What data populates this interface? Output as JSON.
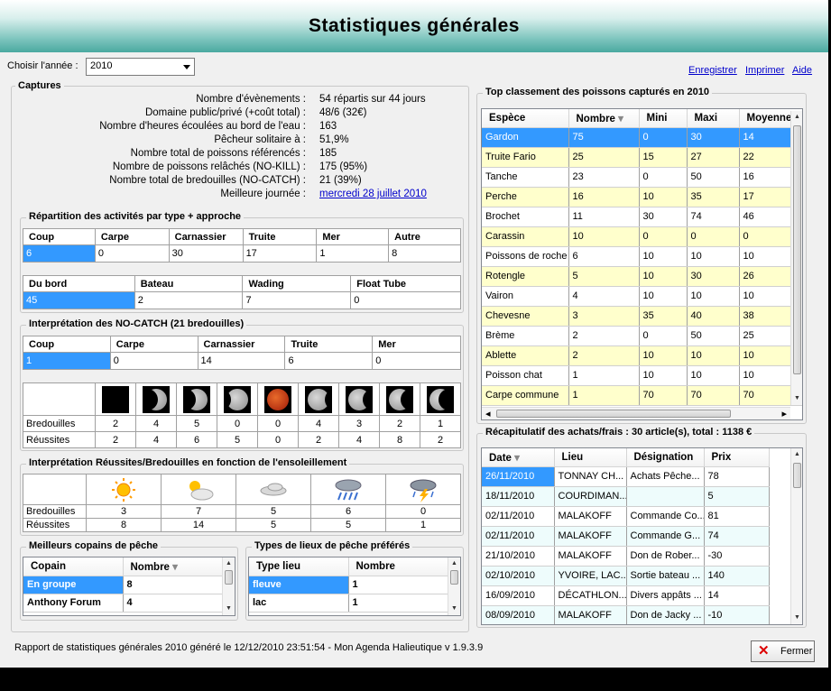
{
  "title": "Statistiques générales",
  "year_label": "Choisir l'année :",
  "year_value": "2010",
  "links": {
    "save": "Enregistrer",
    "print": "Imprimer",
    "help": "Aide"
  },
  "captures": {
    "title": "Captures",
    "stats": [
      {
        "label": "Nombre d'évènements :",
        "value": "54 répartis sur 44 jours"
      },
      {
        "label": "Domaine public/privé (+coût total) :",
        "value": "48/6  (32€)"
      },
      {
        "label": "Nombre d'heures écoulées au bord de l'eau :",
        "value": "163"
      },
      {
        "label": "Pêcheur solitaire à :",
        "value": "51,9%"
      },
      {
        "label": "Nombre total de poissons référencés :",
        "value": "185"
      },
      {
        "label": "Nombre de poissons relâchés (NO-KILL) :",
        "value": "175   (95%)"
      },
      {
        "label": "Nombre total de bredouilles (NO-CATCH) :",
        "value": "21   (39%)"
      },
      {
        "label": "Meilleure journée :",
        "value": "mercredi 28 juillet 2010"
      }
    ]
  },
  "activities": {
    "title": "Répartition des activités par type + approche",
    "type_headers": [
      "Coup",
      "Carpe",
      "Carnassier",
      "Truite",
      "Mer",
      "Autre"
    ],
    "type_values": [
      "6",
      "0",
      "30",
      "17",
      "1",
      "8"
    ],
    "approach_headers": [
      "Du bord",
      "Bateau",
      "Wading",
      "Float Tube"
    ],
    "approach_values": [
      "45",
      "2",
      "7",
      "0"
    ]
  },
  "nocatch": {
    "title": "Interprétation des NO-CATCH (21 bredouilles)",
    "headers": [
      "Coup",
      "Carpe",
      "Carnassier",
      "Truite",
      "Mer"
    ],
    "values": [
      "1",
      "0",
      "14",
      "6",
      "0"
    ],
    "row_labels": [
      "Bredouilles",
      "Réussites"
    ],
    "moons": [
      "new-moon-icon",
      "waxing-crescent-moon-icon",
      "first-quarter-moon-icon",
      "waxing-gibbous-moon-icon",
      "full-moon-icon",
      "waning-gibbous-moon-icon",
      "waning-gibbous-moon-icon",
      "last-quarter-moon-icon",
      "waning-crescent-moon-icon"
    ],
    "bredouilles": [
      "2",
      "4",
      "5",
      "0",
      "0",
      "4",
      "3",
      "2",
      "1"
    ],
    "reussites": [
      "2",
      "4",
      "6",
      "5",
      "0",
      "2",
      "4",
      "8",
      "2"
    ]
  },
  "weather": {
    "title": "Interprétation Réussites/Bredouilles en fonction de l'ensoleillement",
    "row_labels": [
      "Bredouilles",
      "Réussites"
    ],
    "icons": [
      "sun-icon",
      "sun-cloud-icon",
      "cloud-icon",
      "rain-icon",
      "storm-icon"
    ],
    "bredouilles": [
      "3",
      "7",
      "5",
      "6",
      "0"
    ],
    "reussites": [
      "8",
      "14",
      "5",
      "5",
      "1"
    ]
  },
  "buddies": {
    "title": "Meilleurs copains de pêche",
    "headers": [
      "Copain",
      "Nombre"
    ],
    "rows": [
      [
        "En groupe",
        "8"
      ],
      [
        "Anthony Forum",
        "4"
      ]
    ]
  },
  "places": {
    "title": "Types de lieux de pêche préférés",
    "headers": [
      "Type lieu",
      "Nombre"
    ],
    "rows": [
      [
        "fleuve",
        "1"
      ],
      [
        "lac",
        "1"
      ]
    ]
  },
  "top_fish": {
    "title": "Top classement des poissons capturés en 2010",
    "headers": [
      "Espèce",
      "Nombre",
      "Mini",
      "Maxi",
      "Moyenne"
    ],
    "rows": [
      [
        "Gardon",
        "75",
        "0",
        "30",
        "14"
      ],
      [
        "Truite Fario",
        "25",
        "15",
        "27",
        "22"
      ],
      [
        "Tanche",
        "23",
        "0",
        "50",
        "16"
      ],
      [
        "Perche",
        "16",
        "10",
        "35",
        "17"
      ],
      [
        "Brochet",
        "11",
        "30",
        "74",
        "46"
      ],
      [
        "Carassin",
        "10",
        "0",
        "0",
        "0"
      ],
      [
        "Poissons de roche",
        "6",
        "10",
        "10",
        "10"
      ],
      [
        "Rotengle",
        "5",
        "10",
        "30",
        "26"
      ],
      [
        "Vairon",
        "4",
        "10",
        "10",
        "10"
      ],
      [
        "Chevesne",
        "3",
        "35",
        "40",
        "38"
      ],
      [
        "Brème",
        "2",
        "0",
        "50",
        "25"
      ],
      [
        "Ablette",
        "2",
        "10",
        "10",
        "10"
      ],
      [
        "Poisson chat",
        "1",
        "10",
        "10",
        "10"
      ],
      [
        "Carpe commune",
        "1",
        "70",
        "70",
        "70"
      ]
    ]
  },
  "purchases": {
    "title": "Récapitulatif des achats/frais : 30 article(s), total : 1138 €",
    "headers": [
      "Date",
      "Lieu",
      "Désignation",
      "Prix"
    ],
    "rows": [
      [
        "26/11/2010",
        "TONNAY CH...",
        "Achats Pêche...",
        "78"
      ],
      [
        "18/11/2010",
        "COURDIMAN...",
        "",
        "5"
      ],
      [
        "02/11/2010",
        "MALAKOFF",
        "Commande Co...",
        "81"
      ],
      [
        "02/11/2010",
        "MALAKOFF",
        "Commande G...",
        "74"
      ],
      [
        "21/10/2010",
        "MALAKOFF",
        "Don de Rober...",
        "-30"
      ],
      [
        "02/10/2010",
        "YVOIRE, LAC...",
        "Sortie bateau ...",
        "140"
      ],
      [
        "16/09/2010",
        "DÉCATHLON...",
        "Divers appâts ...",
        "14"
      ],
      [
        "08/09/2010",
        "MALAKOFF",
        "Don de Jacky ...",
        "-10"
      ]
    ]
  },
  "footer": "Rapport de statistiques générales 2010 généré le 12/12/2010 23:51:54 - Mon Agenda Halieutique v 1.9.3.9",
  "close_label": "Fermer",
  "colors": {
    "selection": "#3399ff",
    "row_yellow": "#ffffcc",
    "row_cyan": "#eefcfc",
    "link": "#0000cc"
  }
}
